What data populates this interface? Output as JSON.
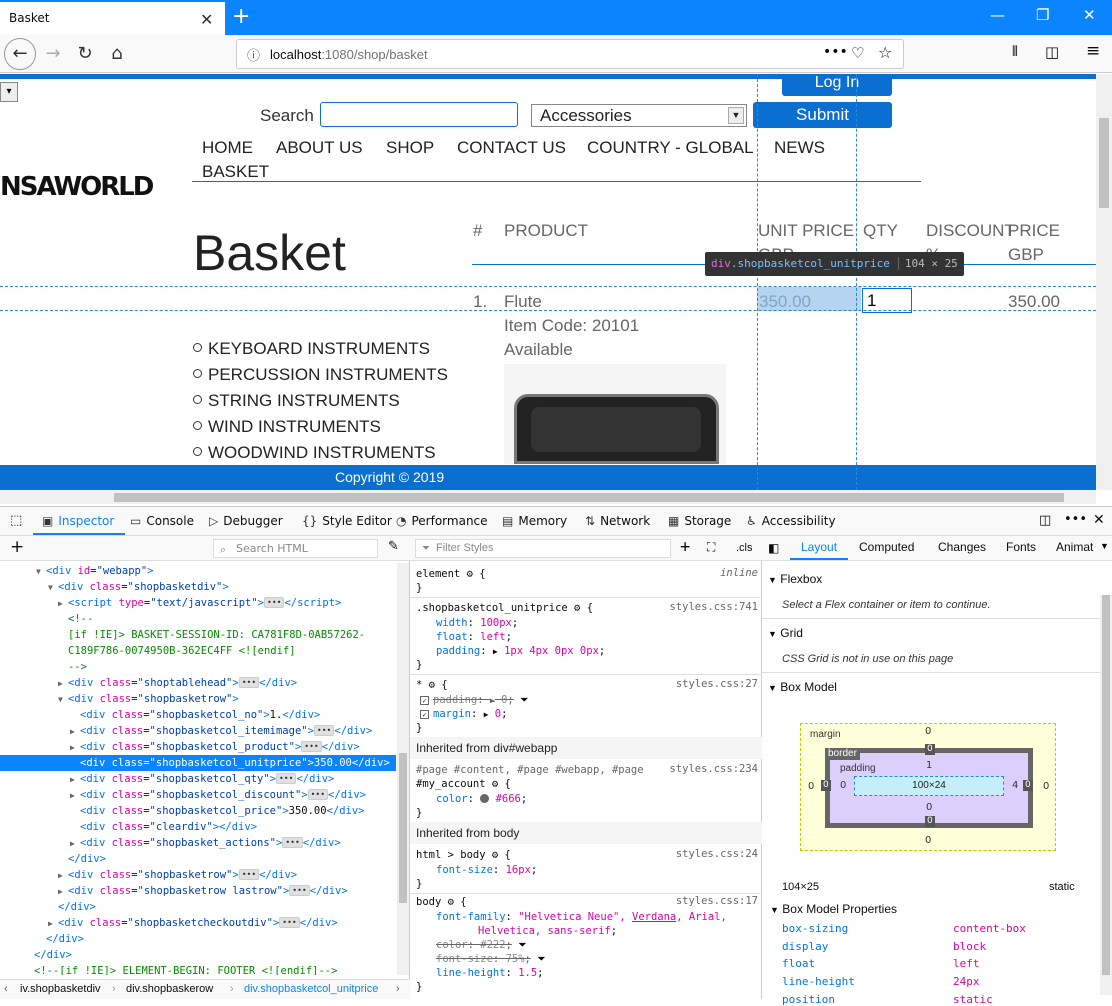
{
  "browser": {
    "tab_title": "Basket",
    "url_host": "localhost",
    "url_path": ":1080/shop/basket"
  },
  "page": {
    "login_label": "Log In",
    "search_label": "Search",
    "search_value": "",
    "category_selected": "Accessories",
    "submit_label": "Submit",
    "logo_text": "NSAWORLD",
    "nav": [
      "HOME",
      "ABOUT US",
      "SHOP",
      "CONTACT US",
      "COUNTRY - GLOBAL",
      "NEWS",
      "BASKET"
    ],
    "basket_title": "Basket",
    "table_headers": {
      "no": "#",
      "product": "PRODUCT",
      "unit_price_1": "UNIT PRICE",
      "unit_price_2": "GBP",
      "qty": "QTY",
      "discount_1": "DISCOUNT",
      "discount_2": "%",
      "price_1": "PRICE",
      "price_2": "GBP"
    },
    "row": {
      "no": "1.",
      "product": "Flute",
      "item_code": "Item Code: 20101",
      "availability": "Available",
      "unit_price": "350.00",
      "qty": "1",
      "price": "350.00"
    },
    "categories": [
      "KEYBOARD INSTRUMENTS",
      "PERCUSSION INSTRUMENTS",
      "STRING INSTRUMENTS",
      "WIND INSTRUMENTS",
      "WOODWIND INSTRUMENTS"
    ],
    "copyright": "Copyright © 2019",
    "tooltip": {
      "tag": "div",
      "class": ".shopbasketcol_unitprice",
      "dims": "104 × 25"
    }
  },
  "devtools": {
    "tabs": [
      "Inspector",
      "Console",
      "Debugger",
      "Style Editor",
      "Performance",
      "Memory",
      "Network",
      "Storage",
      "Accessibility"
    ],
    "search_html_placeholder": "Search HTML",
    "filter_styles_placeholder": "Filter Styles",
    "cls_label": ".cls",
    "breadcrumbs": [
      "iv.shopbasketdiv",
      "div.shopbaskerow",
      "div.shopbasketcol_unitprice"
    ],
    "layout_tabs": [
      "Layout",
      "Computed",
      "Changes",
      "Fonts",
      "Animat"
    ],
    "flexbox": {
      "title": "Flexbox",
      "msg": "Select a Flex container or item to continue."
    },
    "grid": {
      "title": "Grid",
      "msg": "CSS Grid is not in use on this page"
    },
    "box_model": {
      "title": "Box Model",
      "margin_label": "margin",
      "border_label": "border",
      "padding_label": "padding",
      "content": "100×24",
      "margin_top": "0",
      "margin_bottom": "0",
      "margin_left": "0",
      "margin_right": "0",
      "border_top": "0",
      "border_bottom": "0",
      "border_left": "0",
      "border_right": "0",
      "padding_top": "1",
      "padding_bottom": "0",
      "padding_left": "0",
      "padding_right": "4",
      "size": "104×25",
      "position": "static"
    },
    "box_model_properties": {
      "title": "Box Model Properties",
      "items": [
        {
          "name": "box-sizing",
          "value": "content-box"
        },
        {
          "name": "display",
          "value": "block"
        },
        {
          "name": "float",
          "value": "left"
        },
        {
          "name": "line-height",
          "value": "24px"
        },
        {
          "name": "position",
          "value": "static"
        }
      ]
    }
  }
}
